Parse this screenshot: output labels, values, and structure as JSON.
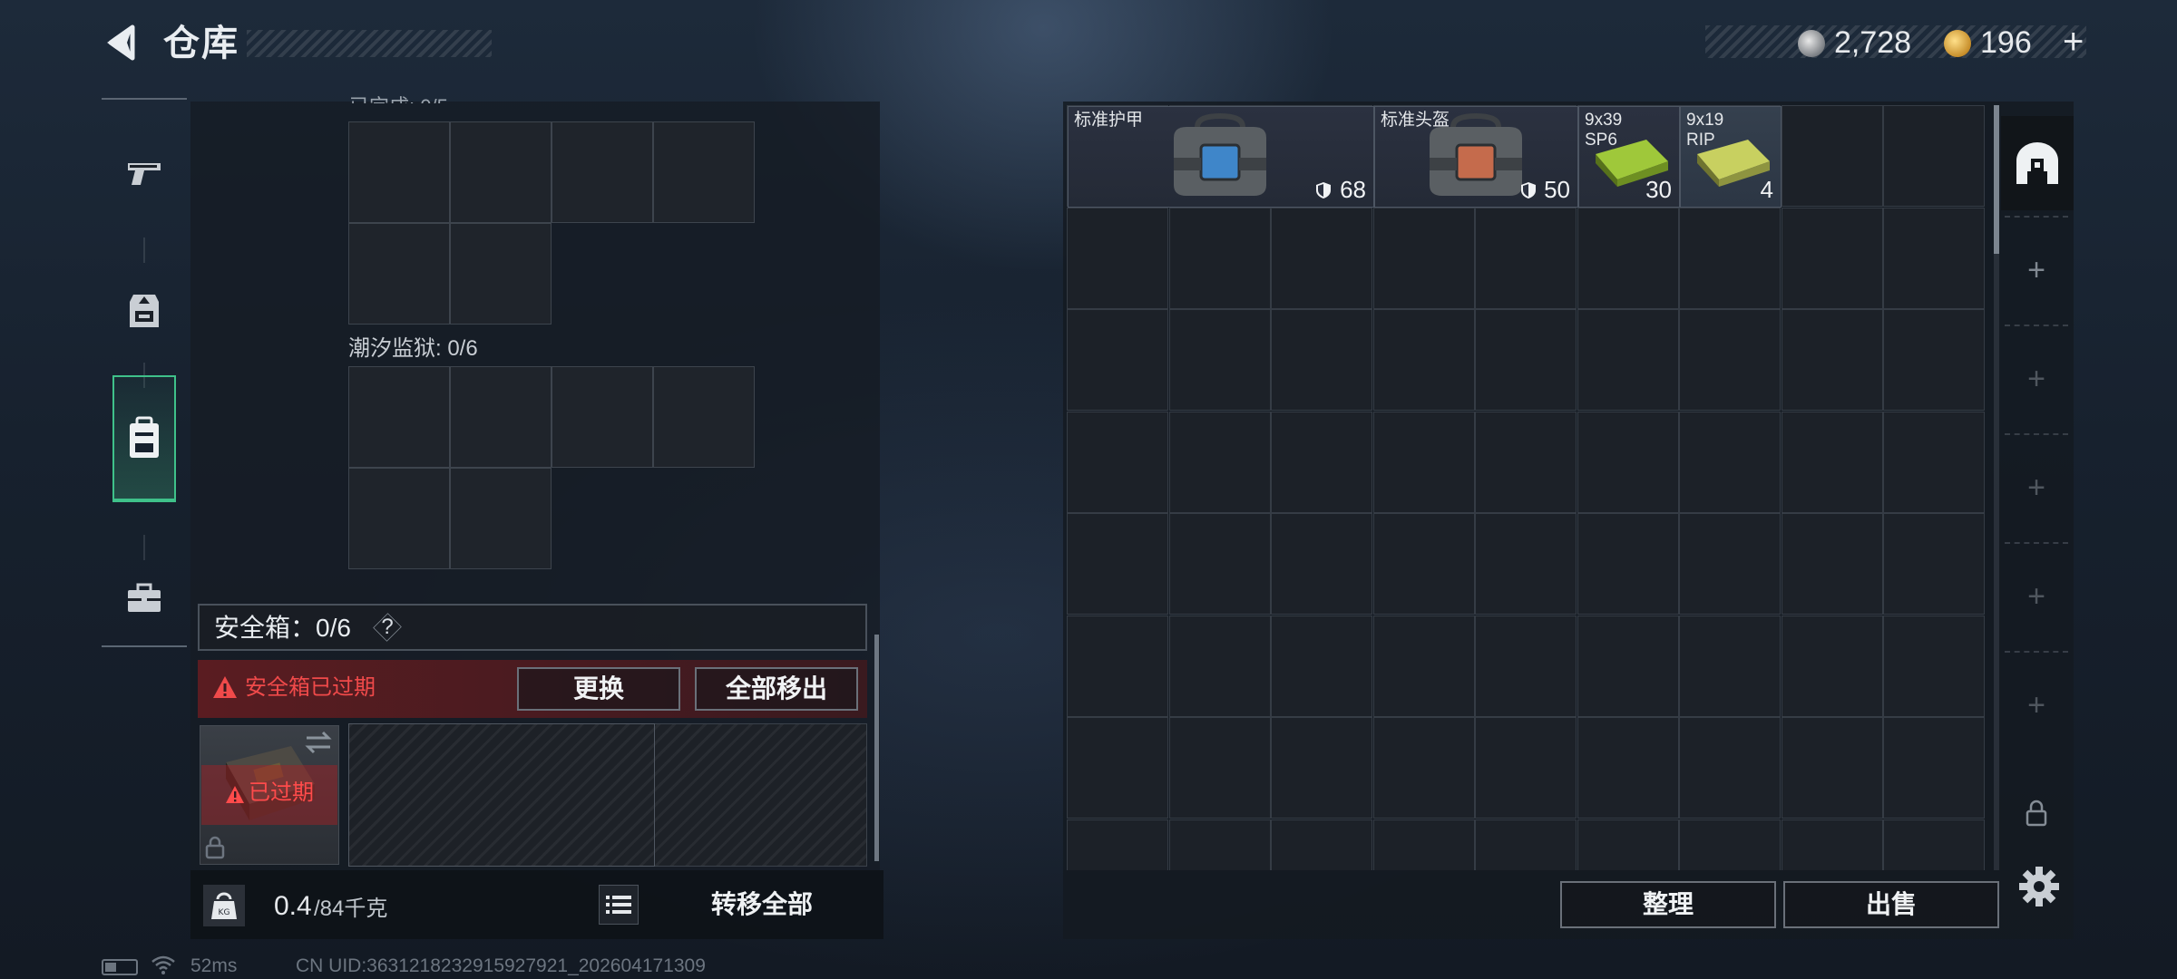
{
  "header": {
    "title": "仓库",
    "coins": [
      {
        "value": "2,728",
        "icon": "silver-coin-icon"
      },
      {
        "value": "196",
        "icon": "gold-coin-icon",
        "add_label": "+"
      }
    ]
  },
  "nav": {
    "items": [
      {
        "icon": "pistol-icon"
      },
      {
        "icon": "chest-rig-icon"
      },
      {
        "icon": "backpack-icon",
        "active": true
      },
      {
        "icon": "toolbox-icon"
      }
    ]
  },
  "left_panel": {
    "grids": [
      {
        "label": "",
        "used": ""
      },
      {
        "label": "潮汐监狱: 0/6"
      }
    ],
    "safe_box": {
      "title": "安全箱：0/6",
      "help": "?",
      "warning": "安全箱已过期",
      "replace_label": "更换",
      "remove_all_label": "全部移出",
      "slot_status": "已过期"
    },
    "bottom": {
      "weight_icon_text": "KG",
      "weight_current": "0.4",
      "weight_max": "/84千克",
      "transfer_all_label": "转移全部"
    }
  },
  "storage": {
    "items": [
      {
        "name": "标准护甲",
        "value": "68",
        "kind": "armor"
      },
      {
        "name": "标准头盔",
        "value": "50",
        "kind": "helmet"
      },
      {
        "name": "9x39\nSP6",
        "value": "30",
        "kind": "ammo"
      },
      {
        "name": "9x19\nRIP",
        "value": "4",
        "kind": "ammo"
      }
    ],
    "organize_label": "整理",
    "sell_label": "出售",
    "side_add_symbol": "+"
  },
  "status_bar": {
    "ping": "52ms",
    "uid": "CN UID:3631218232915927921_202604171309"
  }
}
